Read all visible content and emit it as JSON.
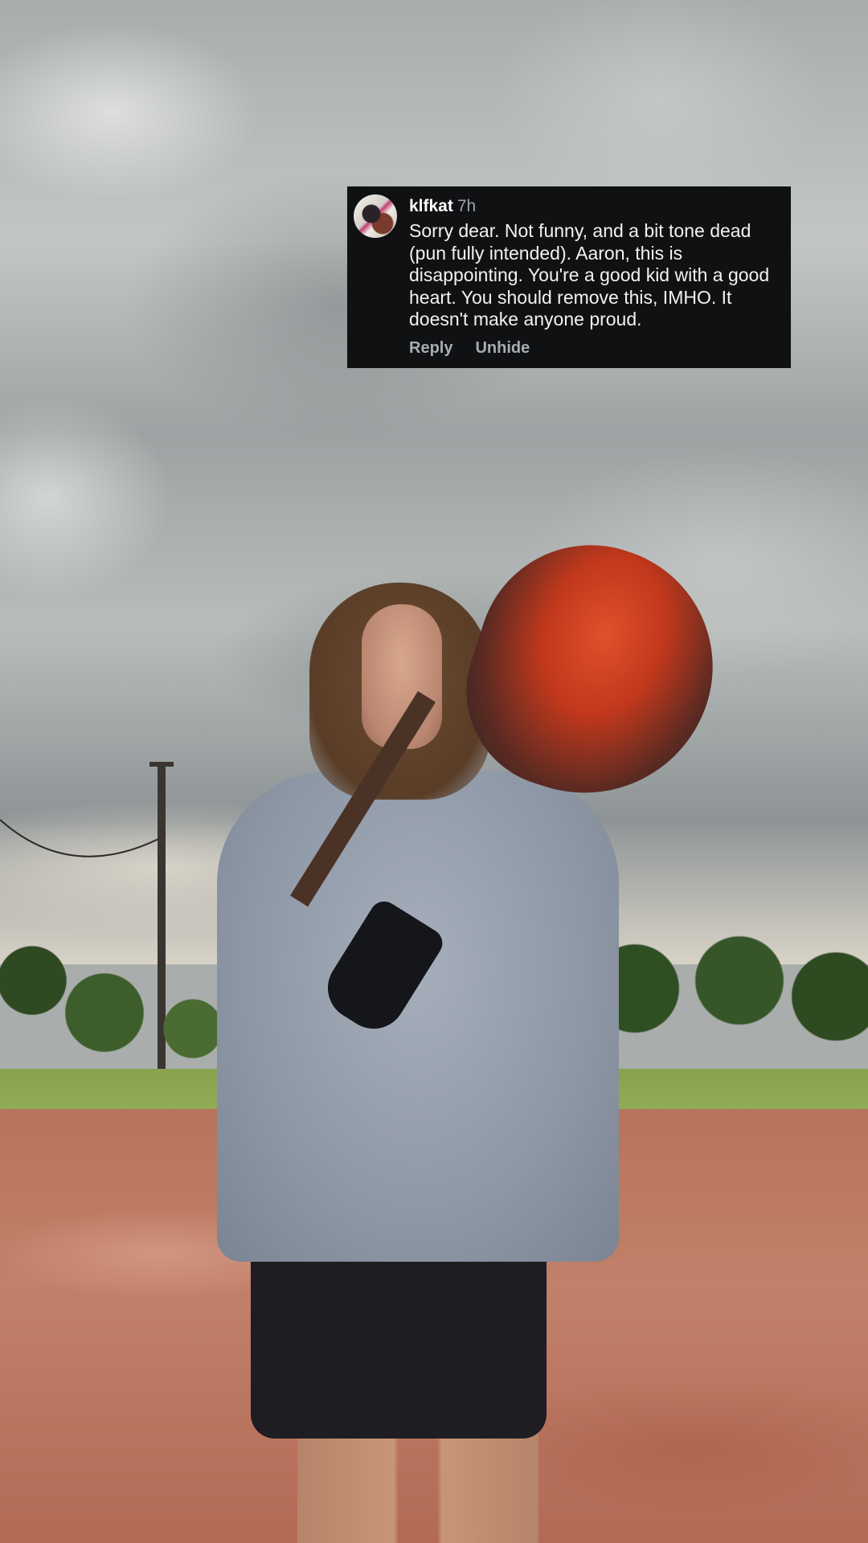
{
  "comment": {
    "username": "klfkat",
    "timestamp": "7h",
    "text": "Sorry dear. Not funny, and a bit tone dead (pun fully intended). Aaron, this is disappointing. You're a good kid with a good heart. You should remove this, IMHO. It doesn't make anyone proud.",
    "actions": {
      "reply": "Reply",
      "unhide": "Unhide"
    }
  },
  "colors": {
    "comment_background": "#0f1113",
    "comment_text": "#ffffff",
    "timestamp": "#9ea2a8",
    "actions": "#a9acb2"
  },
  "background_photo": {
    "icon": "photo-background"
  }
}
